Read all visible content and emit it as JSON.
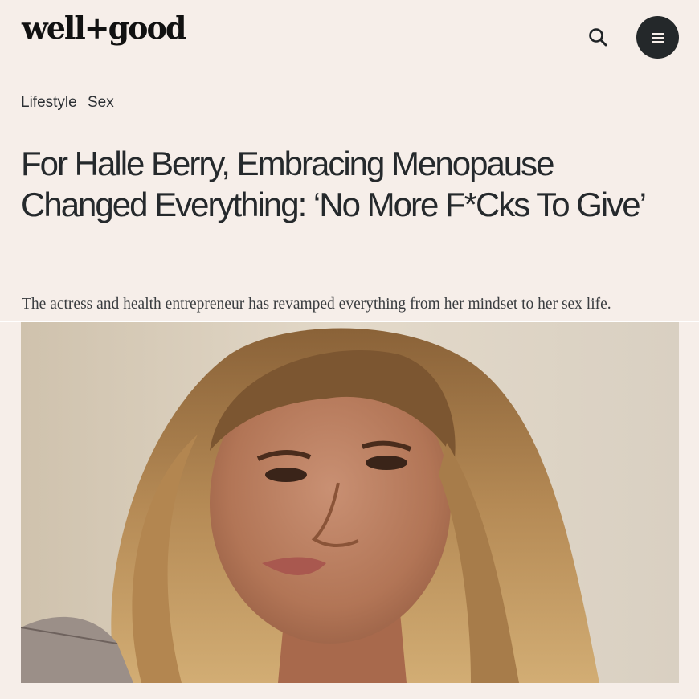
{
  "brand": {
    "logo_text": "well+good"
  },
  "header": {
    "search_icon": "search-icon",
    "menu_icon": "hamburger-menu-icon"
  },
  "tags": [
    "Lifestyle",
    "Sex"
  ],
  "article": {
    "title": "For Halle Berry, Embracing Menopause Changed Everything: ‘No More F*Cks To Give’",
    "dek": "The actress and health entrepreneur has revamped everything from her mindset to her sex life."
  },
  "colors": {
    "background": "#f6eee9",
    "menu_button": "#24282a",
    "text": "#25292c"
  }
}
